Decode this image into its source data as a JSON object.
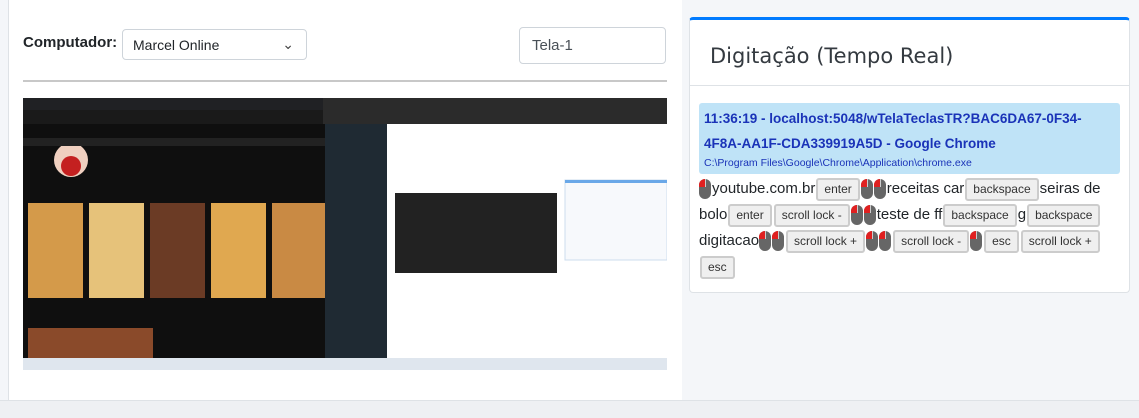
{
  "toolbar": {
    "computer_label": "Computador:",
    "computer_value": "Marcel Online",
    "screen_value": "Tela-1"
  },
  "card": {
    "title": "Digitação (Tempo Real)",
    "window": {
      "title": "11:36:19 - localhost:5048/wTelaTeclasTR?BAC6DA67-0F34-4F8A-AA1F-CDA339919A5D - Google Chrome",
      "path": "C:\\Program Files\\Google\\Chrome\\Application\\chrome.exe"
    },
    "tokens": [
      {
        "type": "mouse",
        "value": "left-click"
      },
      {
        "type": "text",
        "value": "youtube.com.br"
      },
      {
        "type": "key",
        "value": "enter"
      },
      {
        "type": "mouse",
        "value": "left-click"
      },
      {
        "type": "mouse",
        "value": "left-click"
      },
      {
        "type": "text",
        "value": "receitas car"
      },
      {
        "type": "key",
        "value": "backspace"
      },
      {
        "type": "text",
        "value": "seiras de bolo"
      },
      {
        "type": "key",
        "value": "enter"
      },
      {
        "type": "key",
        "value": "scroll lock -"
      },
      {
        "type": "mouse",
        "value": "left-click"
      },
      {
        "type": "mouse",
        "value": "left-click"
      },
      {
        "type": "text",
        "value": "teste de ff"
      },
      {
        "type": "key",
        "value": "backspace"
      },
      {
        "type": "text",
        "value": "g"
      },
      {
        "type": "key",
        "value": "backspace"
      },
      {
        "type": "text",
        "value": "digitacao"
      },
      {
        "type": "mouse",
        "value": "left-click"
      },
      {
        "type": "mouse",
        "value": "left-click"
      },
      {
        "type": "key",
        "value": "scroll lock +"
      },
      {
        "type": "mouse",
        "value": "left-click"
      },
      {
        "type": "mouse",
        "value": "left-click"
      },
      {
        "type": "key",
        "value": "scroll lock -"
      },
      {
        "type": "mouse",
        "value": "left-click"
      },
      {
        "type": "key",
        "value": "esc"
      },
      {
        "type": "key",
        "value": "scroll lock +"
      },
      {
        "type": "key",
        "value": "esc"
      }
    ]
  },
  "colors": {
    "accent": "#007bff",
    "window_bg": "#bfe3f7",
    "window_text": "#1a33b8"
  }
}
